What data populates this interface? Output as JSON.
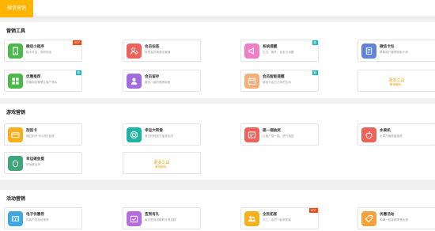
{
  "tab": {
    "label": "微信营销"
  },
  "sections": [
    {
      "title": "营销工具",
      "cards": [
        {
          "title": "微信小程序",
          "desc": "触手可及，用完即走",
          "badge": "HOT",
          "color": "#4cb849",
          "icon": "phone-icon"
        },
        {
          "title": "会员标签",
          "desc": "标签会员精准化营销",
          "badge": "",
          "color": "#f06159",
          "icon": "user-tag-icon"
        },
        {
          "title": "系统提醒",
          "desc": "生日、离开、自定义设置",
          "badge": "新",
          "color": "#f07ec6",
          "icon": "speaker-icon"
        },
        {
          "title": "微信卡包",
          "desc": "帮助用户管理领取卡券",
          "badge": "",
          "color": "#5f83d9",
          "icon": "card-wallet-icon"
        },
        {
          "title": "优惠推荐",
          "desc": "创建商品套餐让客户购买",
          "badge": "新",
          "color": "#4cb849",
          "icon": "grid-icon"
        },
        {
          "title": "会员留存",
          "desc": "最多八级的推荐制度",
          "badge": "",
          "color": "#a26be0",
          "icon": "user-retain-icon"
        },
        {
          "title": "会员智能提醒",
          "desc": "增加与会员之间的互动",
          "badge": "新",
          "color": "#f5b07a",
          "icon": "calendar-icon"
        }
      ],
      "more": {
        "title": "更多工具",
        "sub": "敬请期待..."
      }
    },
    {
      "title": "游戏营销",
      "cards": [
        {
          "title": "刮刮卡",
          "desc": "通过刮开卡片进行抽奖",
          "badge": "",
          "color": "#f6b01c",
          "icon": "scratch-card-icon"
        },
        {
          "title": "幸运大转盘",
          "desc": "常见的转盘式抽奖玩法",
          "badge": "",
          "color": "#1fb5a6",
          "icon": "wheel-icon"
        },
        {
          "title": "摇一摇抽奖",
          "desc": "让客户摇一摇，进行抽奖",
          "badge": "",
          "color": "#f06159",
          "icon": "shake-icon"
        },
        {
          "title": "水果机",
          "desc": "水果方格转盘抽奖",
          "badge": "",
          "color": "#f06159",
          "icon": "fruit-icon"
        },
        {
          "title": "幸运砸金蛋",
          "desc": "好运砸出来",
          "badge": "",
          "color": "#3fa57a",
          "icon": "egg-icon"
        }
      ],
      "more": {
        "title": "更多工具",
        "sub": "敬请期待..."
      }
    },
    {
      "title": "活动营销",
      "cards": [
        {
          "title": "电子优惠券",
          "desc": "向客户发放优惠券",
          "badge": "",
          "color": "#3fa8e0",
          "icon": "coupon-icon"
        },
        {
          "title": "签到有礼",
          "desc": "每日签到领取积分或奖励",
          "badge": "",
          "color": "#b86be0",
          "icon": "checkin-icon"
        },
        {
          "title": "全民拓客",
          "desc": "员工、会员一起来拓客",
          "badge": "HOT",
          "color": "#f6b01c",
          "icon": "people-icon"
        },
        {
          "title": "优惠活动",
          "desc": "和满一定金额享受优惠",
          "badge": "",
          "color": "#f5a23c",
          "icon": "discount-icon"
        }
      ]
    }
  ]
}
